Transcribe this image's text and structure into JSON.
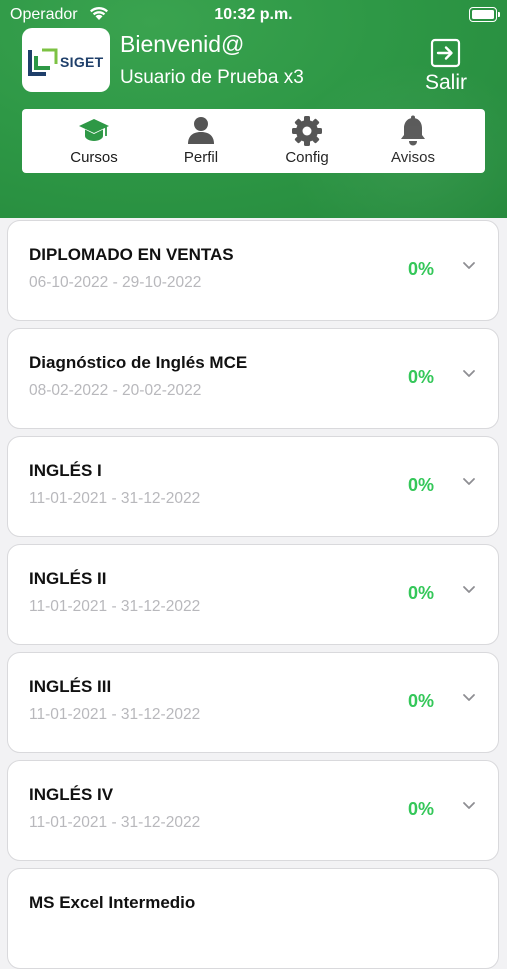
{
  "status_bar": {
    "carrier": "Operador",
    "time": "10:32 p.m."
  },
  "header": {
    "logo_text": "SIGET",
    "welcome": "Bienvenid@",
    "username": "Usuario de Prueba x3",
    "logout_label": "Salir",
    "accent_color": "#2e9846"
  },
  "tabs": [
    {
      "label": "Cursos",
      "icon": "graduation-cap-icon",
      "active": true
    },
    {
      "label": "Perfil",
      "icon": "person-icon",
      "active": false
    },
    {
      "label": "Config",
      "icon": "gear-icon",
      "active": false
    },
    {
      "label": "Avisos",
      "icon": "bell-icon",
      "active": false
    }
  ],
  "courses": [
    {
      "title": "DIPLOMADO EN VENTAS",
      "dates": "06-10-2022 - 29-10-2022",
      "progress": "0%"
    },
    {
      "title": "Diagnóstico de Inglés MCE",
      "dates": "08-02-2022 - 20-02-2022",
      "progress": "0%"
    },
    {
      "title": "INGLÉS I",
      "dates": "11-01-2021 - 31-12-2022",
      "progress": "0%"
    },
    {
      "title": "INGLÉS II",
      "dates": "11-01-2021 - 31-12-2022",
      "progress": "0%"
    },
    {
      "title": "INGLÉS III",
      "dates": "11-01-2021 - 31-12-2022",
      "progress": "0%"
    },
    {
      "title": "INGLÉS IV",
      "dates": "11-01-2021 - 31-12-2022",
      "progress": "0%"
    },
    {
      "title": "MS Excel Intermedio",
      "dates": "",
      "progress": ""
    }
  ],
  "colors": {
    "progress": "#34c759",
    "active_tab": "#2e9846"
  }
}
